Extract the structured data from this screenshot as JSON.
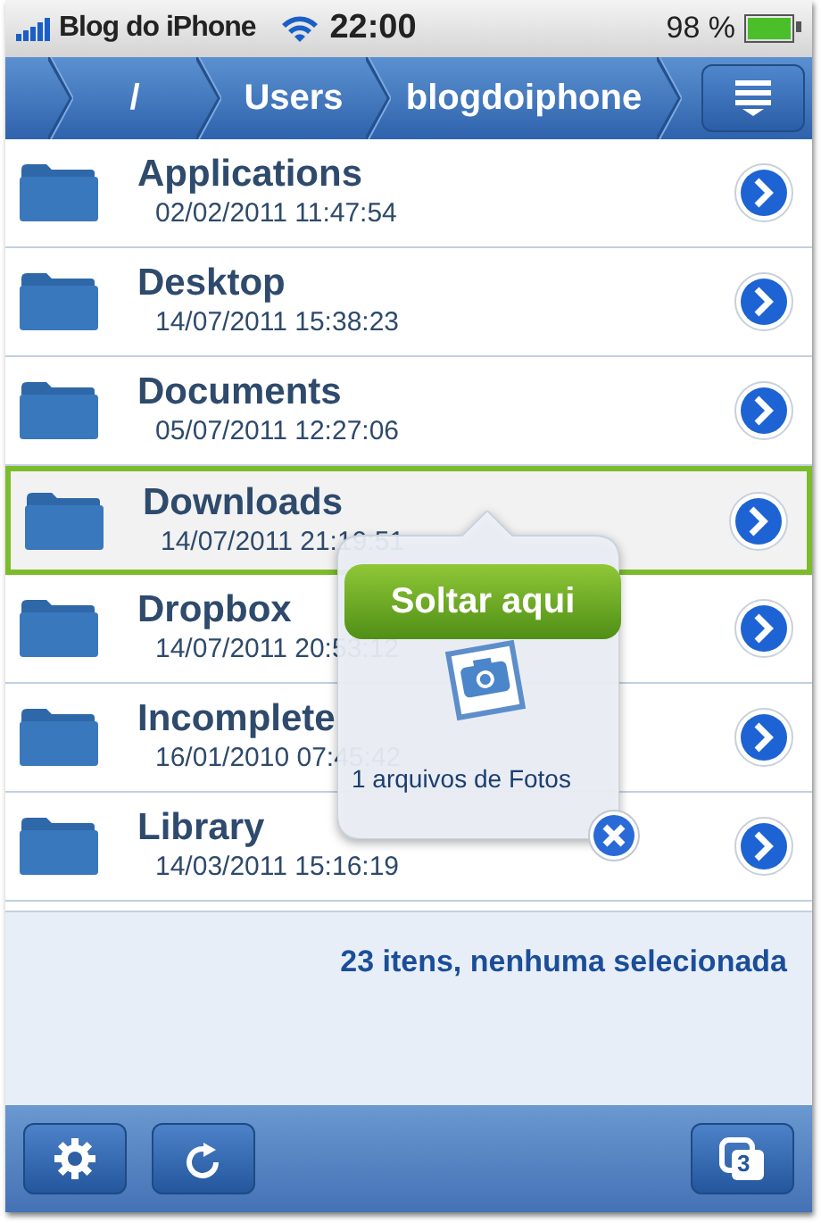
{
  "status_bar": {
    "carrier": "Blog do iPhone",
    "time": "22:00",
    "battery": "98 %"
  },
  "breadcrumbs": [
    {
      "label": "/"
    },
    {
      "label": "Users"
    },
    {
      "label": "blogdoiphone"
    }
  ],
  "files": [
    {
      "name": "Applications",
      "date": "02/02/2011 11:47:54",
      "kind": "folder",
      "highlighted": false
    },
    {
      "name": "Desktop",
      "date": "14/07/2011 15:38:23",
      "kind": "folder",
      "highlighted": false
    },
    {
      "name": "Documents",
      "date": "05/07/2011 12:27:06",
      "kind": "folder",
      "highlighted": false
    },
    {
      "name": "Downloads",
      "date": "14/07/2011 21:19:51",
      "kind": "folder",
      "highlighted": true
    },
    {
      "name": "Dropbox",
      "date": "14/07/2011 20:53:12",
      "kind": "folder",
      "highlighted": false
    },
    {
      "name": "Incomplete",
      "date": "16/01/2010 07:45:42",
      "kind": "folder",
      "highlighted": false
    },
    {
      "name": "Library",
      "date": "14/03/2011 15:16:19",
      "kind": "folder",
      "highlighted": false
    }
  ],
  "summary": "23 itens, nenhuma selecionada",
  "drop_popover": {
    "button": "Soltar aqui",
    "caption": "1 arquivos de Fotos"
  },
  "toolbar": {
    "windows_count": "3"
  }
}
